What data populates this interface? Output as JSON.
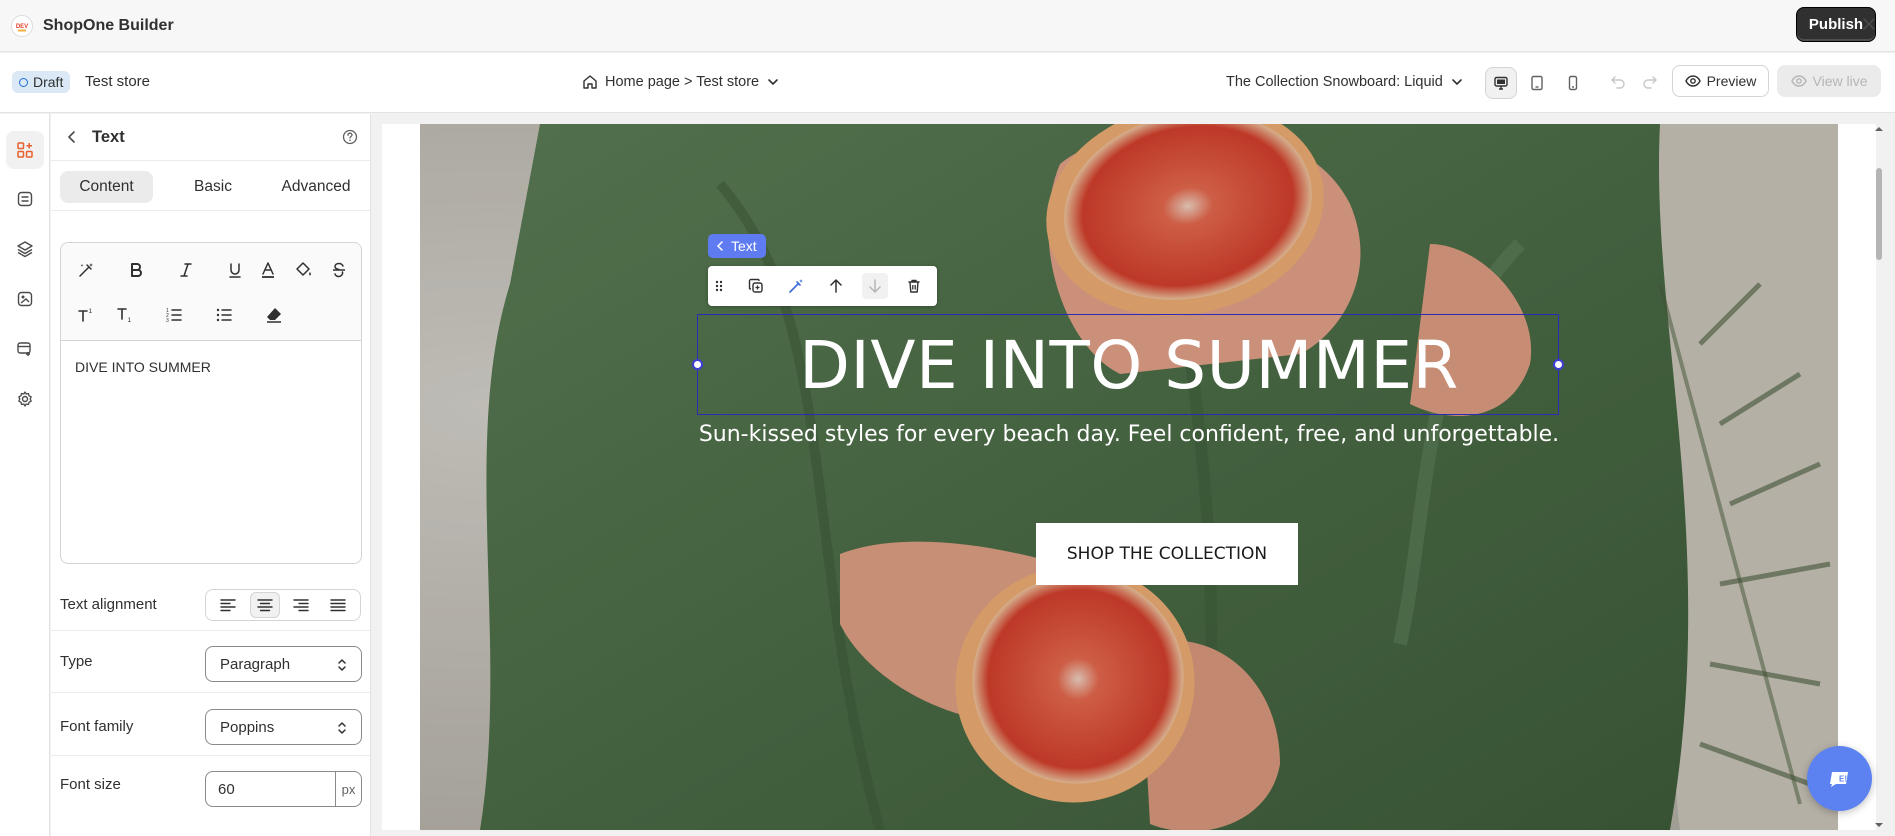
{
  "app": {
    "title": "ShopOne Builder",
    "logo_text": "DEV"
  },
  "topbar": {
    "publish_label": "Publish"
  },
  "subbar": {
    "status_badge": "Draft",
    "store_name": "Test store",
    "page_selector": "Home page > Test store",
    "template_selector": "The Collection Snowboard: Liquid",
    "preview_label": "Preview",
    "view_live_label": "View live"
  },
  "rail": {
    "items": [
      "sections-icon",
      "layout-icon",
      "layers-icon",
      "assets-icon",
      "templates-icon",
      "settings-icon"
    ]
  },
  "panel": {
    "title": "Text",
    "tabs": [
      {
        "label": "Content"
      },
      {
        "label": "Basic"
      },
      {
        "label": "Advanced"
      }
    ],
    "editor_content": "DIVE INTO SUMMER",
    "properties": {
      "text_alignment_label": "Text alignment",
      "type_label": "Type",
      "type_value": "Paragraph",
      "font_family_label": "Font family",
      "font_family_value": "Poppins",
      "font_size_label": "Font size",
      "font_size_value": "60",
      "font_size_unit": "px"
    }
  },
  "canvas": {
    "heading": "DIVE INTO SUMMER",
    "subheading": "Sun-kissed styles for every beach day. Feel confident, free, and unforgettable.",
    "cta_label": "SHOP THE COLLECTION",
    "selection_tag": "Text"
  },
  "colors": {
    "accent": "#5f7bf2",
    "selection_border": "#2b2bb8",
    "publish_bg": "#303030",
    "draft_badge_bg": "#dbe9f6",
    "chat_button": "#5b82f0"
  }
}
